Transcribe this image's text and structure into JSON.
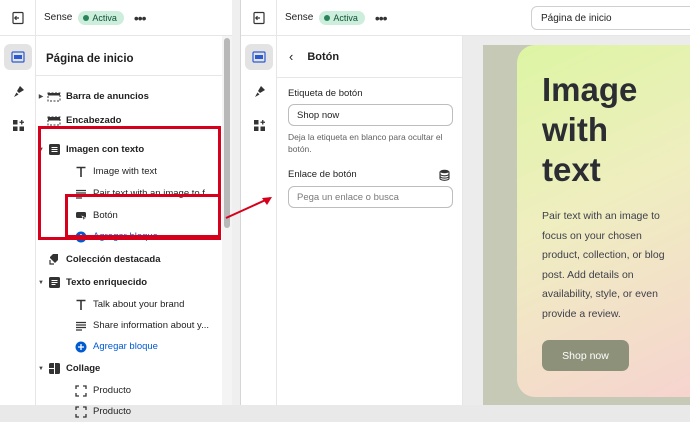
{
  "left": {
    "store_name": "Sense",
    "status_badge": "Activa",
    "more_label": "•••",
    "panel_title": "Página de inicio",
    "tree": [
      {
        "label": "Barra de anuncios",
        "kind": "section",
        "caret": "▶",
        "icon": "announcement-bar-icon"
      },
      {
        "label": "Encabezado",
        "kind": "section",
        "caret": "",
        "icon": "header-icon"
      },
      {
        "label": "Imagen con texto",
        "kind": "section",
        "caret": "▼",
        "icon": "image-text-icon"
      },
      {
        "label": "Image with text",
        "kind": "child",
        "icon": "text-icon"
      },
      {
        "label": "Pair text with an image to f...",
        "kind": "child",
        "icon": "paragraph-icon"
      },
      {
        "label": "Botón",
        "kind": "child",
        "icon": "button-block-icon"
      },
      {
        "label": "Agregar bloque",
        "kind": "add",
        "icon": "plus-circle-icon"
      },
      {
        "label": "Colección destacada",
        "kind": "section",
        "caret": "",
        "icon": "collection-icon"
      },
      {
        "label": "Texto enriquecido",
        "kind": "section",
        "caret": "▼",
        "icon": "rich-text-icon"
      },
      {
        "label": "Talk about your brand",
        "kind": "child",
        "icon": "text-icon"
      },
      {
        "label": "Share information about y...",
        "kind": "child",
        "icon": "paragraph-icon"
      },
      {
        "label": "Agregar bloque",
        "kind": "add",
        "icon": "plus-circle-icon"
      },
      {
        "label": "Collage",
        "kind": "section",
        "caret": "▼",
        "icon": "collage-icon"
      },
      {
        "label": "Producto",
        "kind": "child",
        "icon": "product-frame-icon"
      },
      {
        "label": "Producto",
        "kind": "child",
        "icon": "product-frame-icon"
      }
    ]
  },
  "right": {
    "store_name": "Sense",
    "status_badge": "Activa",
    "more_label": "•••",
    "page_selector": "Página de inicio",
    "panel_title": "Botón",
    "button_label_field": {
      "label": "Etiqueta de botón",
      "value": "Shop now",
      "help": "Deja la etiqueta en blanco para ocultar el botón."
    },
    "button_link_field": {
      "label": "Enlace de botón",
      "placeholder": "Pega un enlace o busca"
    },
    "preview": {
      "title_lines": [
        "Image",
        "with",
        "text"
      ],
      "body": "Pair text with an image to focus on your chosen product, collection, or blog post. Add details on availability, style, or even provide a review.",
      "button": "Shop now"
    }
  },
  "colors": {
    "highlight": "#d6001c",
    "link_blue": "#005bd3",
    "badge_bg": "#cdeedd",
    "badge_dot": "#29845a"
  }
}
